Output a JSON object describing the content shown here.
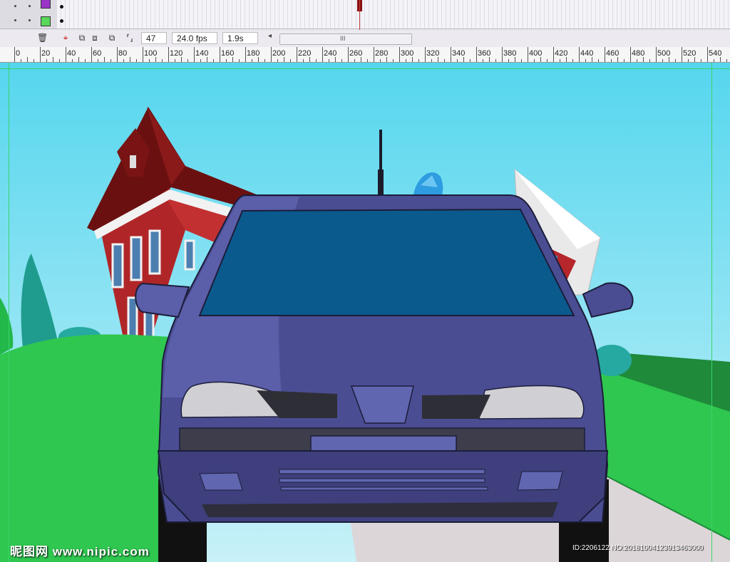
{
  "timeline": {
    "current_frame": "47",
    "frame_rate": "24.0 fps",
    "elapsed_time": "1.9s",
    "scroll_grip": "III",
    "scroll_left": "◂",
    "layers": [
      {
        "color": "#9a34c8"
      },
      {
        "color": "#5ad85a"
      }
    ]
  },
  "icons": {
    "trash": "🗑",
    "onion": "⬦",
    "edit_multiple": "⧉"
  },
  "ruler": {
    "labels": [
      "0",
      "20",
      "40",
      "60",
      "80",
      "100",
      "120",
      "140",
      "160",
      "180",
      "200",
      "220",
      "240",
      "260",
      "280",
      "300",
      "320",
      "340",
      "360",
      "380",
      "400",
      "420",
      "440",
      "460",
      "480",
      "500",
      "520",
      "540"
    ]
  },
  "watermark": {
    "logo": "昵图网 www.nipic.com",
    "id": "ID:2206122 NO:20181004123913463000"
  },
  "colors": {
    "sky_top": "#5ad8ef",
    "sky_bottom": "#c5f0f8",
    "grass": "#2fc74f",
    "car_body": "#4b4d93",
    "windshield": "#0a5a8e",
    "house_red": "#b6262a",
    "roof": "#6b1010"
  }
}
